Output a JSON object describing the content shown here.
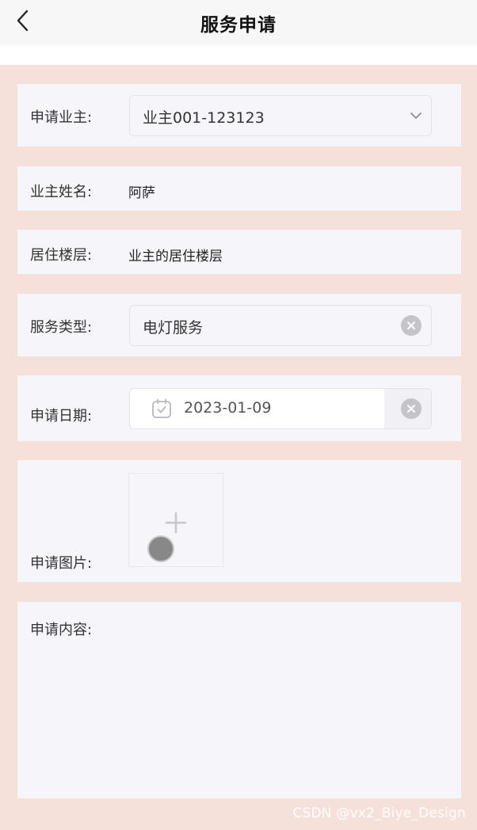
{
  "nav": {
    "title": "服务申请",
    "back_icon": "chevron-left-icon"
  },
  "form": {
    "owner": {
      "label": "申请业主:",
      "value": "业主001-123123",
      "icon": "chevron-down-icon"
    },
    "owner_name": {
      "label": "业主姓名:",
      "value": "阿萨"
    },
    "floor": {
      "label": "居住楼层:",
      "value": "业主的居住楼层"
    },
    "service_type": {
      "label": "服务类型:",
      "value": "电灯服务",
      "icon": "clear-icon"
    },
    "apply_date": {
      "label": "申请日期:",
      "value": "2023-01-09",
      "icon": "calendar-icon"
    },
    "images": {
      "label": "申请图片:",
      "icon": "plus-icon"
    },
    "content": {
      "label": "申请内容:",
      "value": ""
    }
  },
  "watermark": "CSDN @vx2_Biye_Design",
  "colors": {
    "page_bg": "#f5e0da",
    "row_bg": "#f6f6fa",
    "clear_icon": "#c4c4ca"
  }
}
